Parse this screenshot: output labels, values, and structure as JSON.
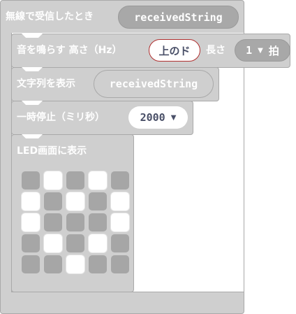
{
  "radio_block": {
    "label": "無線で受信したとき",
    "variable": "receivedString"
  },
  "tone_block": {
    "label": "音を鳴らす 高さ（Hz）",
    "note": "上のド",
    "duration_label": "長さ",
    "beats_value": "1",
    "beats_unit": "拍"
  },
  "show_string_block": {
    "label": "文字列を表示",
    "value": "receivedString"
  },
  "pause_block": {
    "label": "一時停止（ミリ秒）",
    "value": "2000"
  },
  "leds_block": {
    "label": "LED画面に表示",
    "grid": [
      [
        0,
        1,
        0,
        1,
        0
      ],
      [
        1,
        0,
        1,
        0,
        1
      ],
      [
        1,
        0,
        0,
        0,
        1
      ],
      [
        0,
        1,
        0,
        1,
        0
      ],
      [
        0,
        0,
        1,
        0,
        0
      ]
    ]
  },
  "colors": {
    "block": "#cfcfcf",
    "border": "#a9a9a9",
    "led_on": "#ffffff",
    "led_off": "#a6a6a6",
    "note_border": "#b03030"
  }
}
